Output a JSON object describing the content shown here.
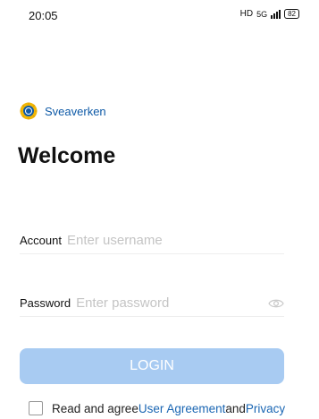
{
  "status_bar": {
    "time": "20:05",
    "network": "HD",
    "net_type": "5G",
    "battery": "82"
  },
  "brand": {
    "name": "Sveaverken",
    "logo_icon": "sveaverken-logo-icon",
    "color": "#0e5aa7"
  },
  "welcome": {
    "title": "Welcome"
  },
  "form": {
    "account": {
      "label": "Account",
      "placeholder": "Enter username",
      "value": ""
    },
    "password": {
      "label": "Password",
      "placeholder": "Enter password",
      "value": "",
      "visibility_icon": "eye-icon"
    }
  },
  "login_button": {
    "label": "LOGIN",
    "color": "#a8cbf2"
  },
  "agreement": {
    "checked": false,
    "prefix": "Read and agree",
    "user_agreement": "User Agreement",
    "conjunction": "and",
    "privacy": "Privacy",
    "link_color": "#1a66b3"
  }
}
